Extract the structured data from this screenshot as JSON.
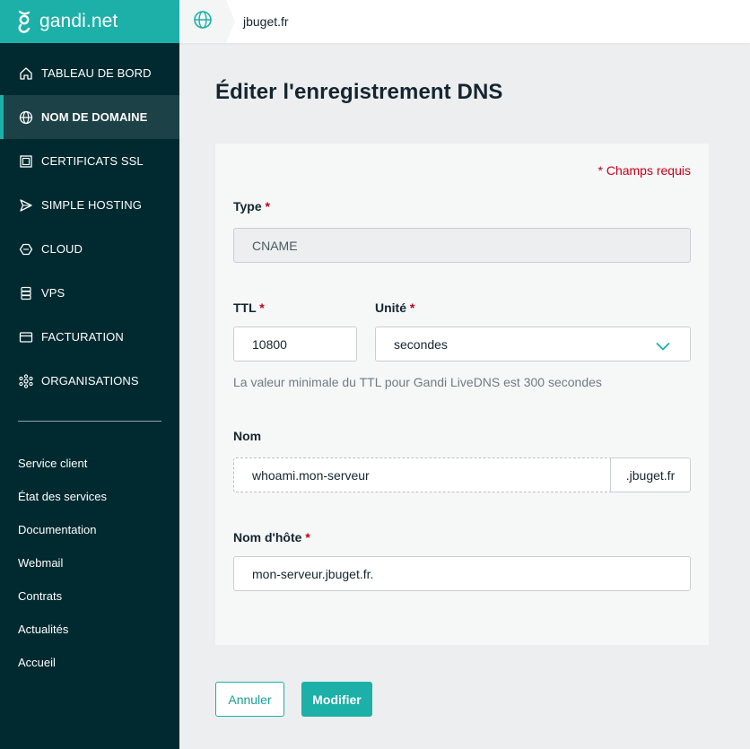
{
  "brand": {
    "name": "gandi.net",
    "accent": "#1cb0a8",
    "sidebar_bg": "#002a30"
  },
  "topbar": {
    "breadcrumb": "jbuget.fr",
    "icon": "globe-icon"
  },
  "sidebar": {
    "items": [
      {
        "label": "TABLEAU DE BORD",
        "icon": "home-icon",
        "active": false
      },
      {
        "label": "NOM DE DOMAINE",
        "icon": "globe-icon",
        "active": true
      },
      {
        "label": "CERTIFICATS SSL",
        "icon": "certificate-icon",
        "active": false
      },
      {
        "label": "SIMPLE HOSTING",
        "icon": "send-icon",
        "active": false
      },
      {
        "label": "CLOUD",
        "icon": "hexagon-icon",
        "active": false
      },
      {
        "label": "VPS",
        "icon": "server-icon",
        "active": false
      },
      {
        "label": "FACTURATION",
        "icon": "card-icon",
        "active": false
      },
      {
        "label": "ORGANISATIONS",
        "icon": "network-icon",
        "active": false
      }
    ],
    "links": [
      "Service client",
      "État des services",
      "Documentation",
      "Webmail",
      "Contrats",
      "Actualités",
      "Accueil"
    ]
  },
  "page": {
    "title": "Éditer l'enregistrement DNS"
  },
  "form": {
    "required_note": "* Champs requis",
    "type": {
      "label": "Type",
      "star": "*",
      "value": "CNAME"
    },
    "ttl": {
      "label": "TTL",
      "star": "*",
      "value": "10800"
    },
    "unit": {
      "label": "Unité",
      "star": "*",
      "value": "secondes"
    },
    "ttl_hint": "La valeur minimale du TTL pour Gandi LiveDNS est 300 secondes",
    "name": {
      "label": "Nom",
      "value": "whoami.mon-serveur",
      "suffix": ".jbuget.fr"
    },
    "hostname": {
      "label": "Nom d'hôte",
      "star": "*",
      "value": "mon-serveur.jbuget.fr."
    }
  },
  "actions": {
    "cancel": "Annuler",
    "submit": "Modifier"
  }
}
